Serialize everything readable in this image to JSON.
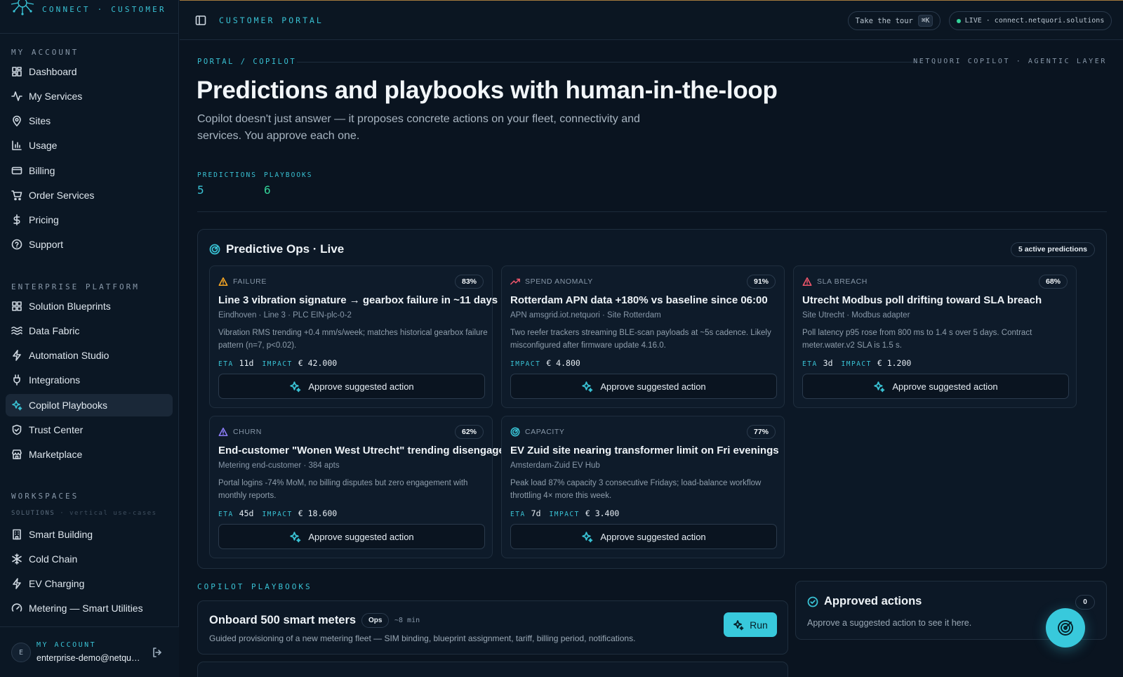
{
  "brand": {
    "subtitle": "CONNECT · CUSTOMER"
  },
  "sidebar": {
    "my_account_label": "MY ACCOUNT",
    "my_account_items": [
      {
        "label": "Dashboard",
        "icon": "dashboard-icon"
      },
      {
        "label": "My Services",
        "icon": "activity-icon"
      },
      {
        "label": "Sites",
        "icon": "map-pin-icon"
      },
      {
        "label": "Usage",
        "icon": "bar-chart-icon"
      },
      {
        "label": "Billing",
        "icon": "credit-card-icon"
      },
      {
        "label": "Order Services",
        "icon": "cart-icon"
      },
      {
        "label": "Pricing",
        "icon": "dollar-icon"
      },
      {
        "label": "Support",
        "icon": "help-circle-icon"
      }
    ],
    "enterprise_label": "ENTERPRISE PLATFORM",
    "enterprise_items": [
      {
        "label": "Solution Blueprints",
        "icon": "blueprint-icon"
      },
      {
        "label": "Data Fabric",
        "icon": "waves-icon"
      },
      {
        "label": "Automation Studio",
        "icon": "lightning-icon"
      },
      {
        "label": "Integrations",
        "icon": "plug-icon"
      },
      {
        "label": "Copilot Playbooks",
        "icon": "sparkles-icon",
        "active": true
      },
      {
        "label": "Trust Center",
        "icon": "shield-icon"
      },
      {
        "label": "Marketplace",
        "icon": "store-icon"
      }
    ],
    "workspaces_label": "WORKSPACES",
    "solutions_label": "SOLUTIONS",
    "solutions_hint": "· vertical use-cases",
    "workspace_items": [
      {
        "label": "Smart Building",
        "icon": "building-icon"
      },
      {
        "label": "Cold Chain",
        "icon": "snowflake-icon"
      },
      {
        "label": "EV Charging",
        "icon": "bolt-icon"
      },
      {
        "label": "Metering — Smart Utilities",
        "icon": "gauge-icon"
      }
    ],
    "account": {
      "initial": "E",
      "label": "MY ACCOUNT",
      "email": "enterprise-demo@netquori.solutions"
    }
  },
  "topbar": {
    "title": "CUSTOMER PORTAL",
    "tour_label": "Take the tour",
    "tour_shortcut": "⌘K",
    "live_label": "LIVE · connect.netquori.solutions"
  },
  "main": {
    "breadcrumb": "PORTAL / COPILOT",
    "breadcrumb_right": "NETQUORI COPILOT · AGENTIC LAYER",
    "title": "Predictions and playbooks with human-in-the-loop",
    "description": "Copilot doesn't just answer — it proposes concrete actions on your fleet, connectivity and services. You approve each one.",
    "stats": [
      {
        "label": "PREDICTIONS",
        "value": "5"
      },
      {
        "label": "PLAYBOOKS",
        "value": "6"
      }
    ]
  },
  "ops": {
    "title": "Predictive Ops · Live",
    "badge": "5 active predictions",
    "eta_label": "ETA",
    "impact_label": "IMPACT",
    "approve_label": "Approve suggested action",
    "cards": [
      {
        "type": "FAILURE",
        "icon": "warning-triangle-icon",
        "color": "#f5a524",
        "pct": "83%",
        "title": "Line 3 vibration signature → gearbox failure in ~11 days",
        "sub": "Eindhoven · Line 3 · PLC EIN-plc-0-2",
        "desc": "Vibration RMS trending +0.4 mm/s/week; matches historical gearbox failure pattern (n=7, p<0.02).",
        "eta": "11d",
        "impact": "€ 42.000"
      },
      {
        "type": "SPEND ANOMALY",
        "icon": "trending-up-icon",
        "color": "#f0566b",
        "pct": "91%",
        "title": "Rotterdam APN data +180% vs baseline since 06:00",
        "sub": "APN amsgrid.iot.netquori · Site Rotterdam",
        "desc": "Two reefer trackers streaming BLE-scan payloads at ~5s cadence. Likely misconfigured after firmware update 4.16.0.",
        "eta": "",
        "impact": "€ 4.800"
      },
      {
        "type": "SLA BREACH",
        "icon": "alert-triangle-icon",
        "color": "#f0566b",
        "pct": "68%",
        "title": "Utrecht Modbus poll drifting toward SLA breach",
        "sub": "Site Utrecht · Modbus adapter",
        "desc": "Poll latency p95 rose from 800 ms to 1.4 s over 5 days. Contract meter.water.v2 SLA is 1.5 s.",
        "eta": "3d",
        "impact": "€ 1.200"
      },
      {
        "type": "CHURN",
        "icon": "churn-triangle-icon",
        "color": "#8b7cf6",
        "pct": "62%",
        "title": "End-customer \"Wonen West Utrecht\" trending disengaged",
        "sub": "Metering end-customer · 384 apts",
        "desc": "Portal logins -74% MoM, no billing disputes but zero engagement with monthly reports.",
        "eta": "45d",
        "impact": "€ 18.600"
      },
      {
        "type": "CAPACITY",
        "icon": "radar-icon",
        "color": "#39c2d4",
        "pct": "77%",
        "title": "EV Zuid site nearing transformer limit on Fri evenings",
        "sub": "Amsterdam-Zuid EV Hub",
        "desc": "Peak load 87% capacity 3 consecutive Fridays; load-balance workflow throttling 4× more this week.",
        "eta": "7d",
        "impact": "€ 3.400"
      }
    ]
  },
  "playbooks": {
    "section_label": "COPILOT PLAYBOOKS",
    "run_label": "Run",
    "items": [
      {
        "title": "Onboard 500 smart meters",
        "tag": "Ops",
        "time": "~8 min",
        "desc": "Guided provisioning of a new metering fleet — SIM binding, blueprint assignment, tariff, billing period, notifications."
      }
    ]
  },
  "approved": {
    "title": "Approved actions",
    "count": "0",
    "hint": "Approve a suggested action to see it here."
  },
  "colors": {
    "accent": "#39c2d4",
    "success": "#34d399",
    "background": "#0a1420"
  }
}
